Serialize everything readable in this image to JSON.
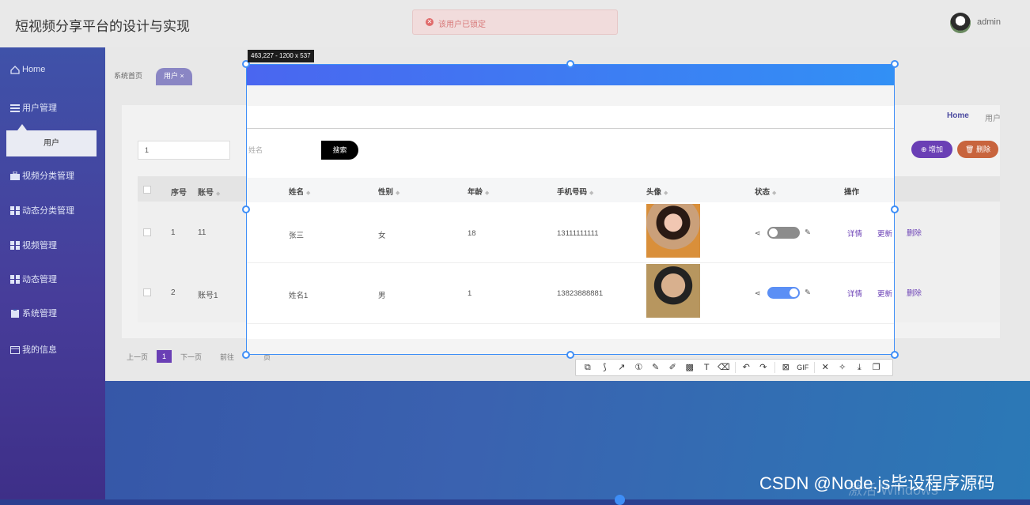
{
  "header": {
    "app_title": "短视频分享平台的设计与实现",
    "toast": "该用户已锁定",
    "username": "admin"
  },
  "sidebar": {
    "items": [
      {
        "label": "Home"
      },
      {
        "label": "用户管理"
      },
      {
        "label": "视频分类管理"
      },
      {
        "label": "动态分类管理"
      },
      {
        "label": "视频管理"
      },
      {
        "label": "动态管理"
      },
      {
        "label": "系统管理"
      },
      {
        "label": "我的信息"
      }
    ],
    "active_sub": "用户"
  },
  "tabs": [
    {
      "label": "系统首页"
    },
    {
      "label": "用户 ×"
    }
  ],
  "breadcrumb": {
    "home": "Home",
    "current": "用户"
  },
  "search": {
    "account_value": "1",
    "name_placeholder": "姓名",
    "button": "搜索",
    "add": "增加",
    "delete": "删除"
  },
  "table": {
    "headers": [
      "序号",
      "账号",
      "姓名",
      "性别",
      "年龄",
      "手机号码",
      "头像",
      "状态",
      "操作"
    ],
    "rows": [
      {
        "index": "1",
        "account": "11",
        "name": "张三",
        "gender": "女",
        "age": "18",
        "phone": "13111111111",
        "status_on": false
      },
      {
        "index": "2",
        "account": "账号1",
        "name": "姓名1",
        "gender": "男",
        "age": "1",
        "phone": "13823888881",
        "status_on": true
      }
    ],
    "actions": {
      "detail": "详情",
      "update": "更新",
      "delete": "删除"
    }
  },
  "pagination": {
    "prev": "上一页",
    "current": "1",
    "next": "下一页",
    "goto": "前往",
    "page_unit": "页"
  },
  "capture": {
    "dimensions": "463,227 - 1200 x 537",
    "gif_label": "GIF"
  },
  "watermark": {
    "csdn": "CSDN @Node.js毕设程序源码",
    "windows": "激活 Windows"
  },
  "colors": {
    "accent": "#6a3fb5",
    "selection": "#3e8ef7",
    "delete": "#c8643d"
  }
}
